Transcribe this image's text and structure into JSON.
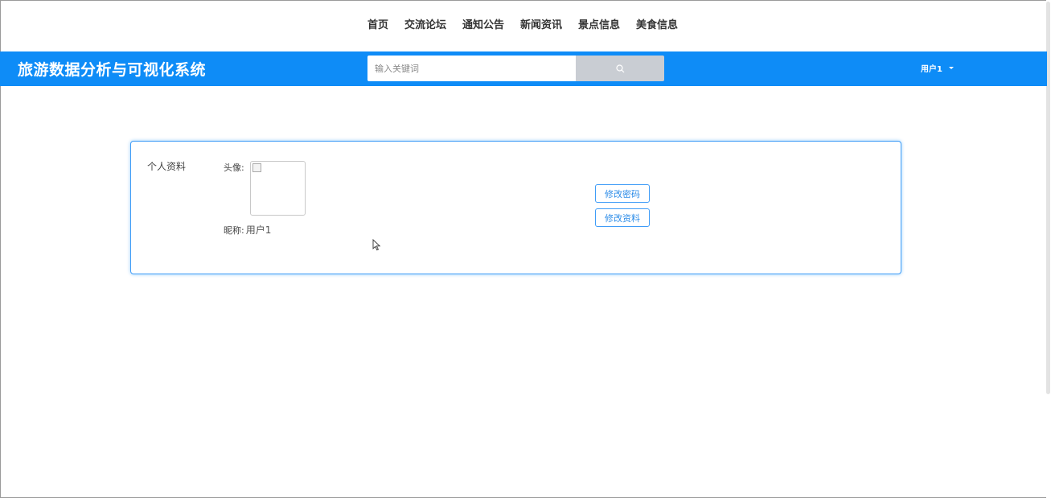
{
  "nav": {
    "items": [
      {
        "label": "首页"
      },
      {
        "label": "交流论坛"
      },
      {
        "label": "通知公告"
      },
      {
        "label": "新闻资讯"
      },
      {
        "label": "景点信息"
      },
      {
        "label": "美食信息"
      }
    ]
  },
  "header": {
    "title": "旅游数据分析与可视化系统",
    "search_placeholder": "输入关键词",
    "search_icon": "search-icon",
    "user_label": "用户1",
    "user_caret_icon": "caret-down-icon"
  },
  "profile": {
    "section_label": "个人资料",
    "avatar_label": "头像:",
    "nickname_label": "昵称:",
    "nickname_value": "用户1",
    "change_password_label": "修改密码",
    "edit_profile_label": "修改资料"
  },
  "colors": {
    "header_bg": "#0e8cf7",
    "accent": "#3f9cf7",
    "search_button_bg": "#c9cdd3"
  }
}
